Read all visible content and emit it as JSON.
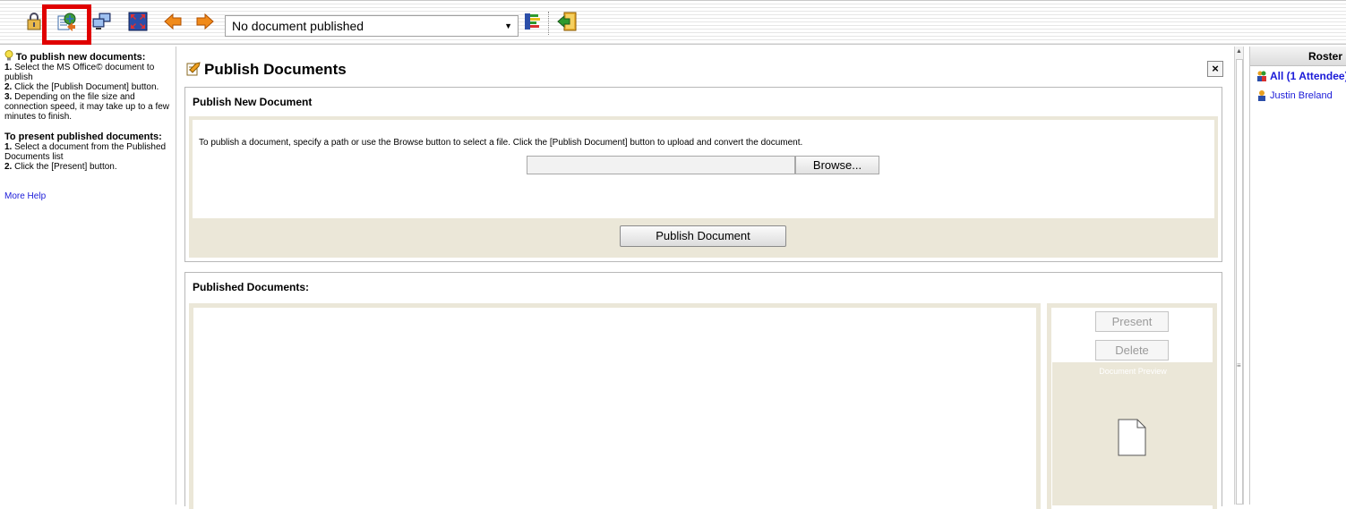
{
  "toolbar": {
    "document_select": {
      "value": "No document published"
    },
    "buttons": [
      "lock-icon",
      "publish-documents-icon",
      "share-desktop-icon",
      "fullscreen-icon",
      "previous-arrow-icon",
      "next-arrow-icon",
      "status-bars-icon",
      "exit-icon"
    ]
  },
  "help": {
    "publish_heading": "To publish new documents:",
    "publish_steps": [
      {
        "num": "1.",
        "text": " Select the MS Office© document to publish"
      },
      {
        "num": "2.",
        "text": " Click the [Publish Document] button."
      },
      {
        "num": "3.",
        "text": " Depending on the file size and connection speed, it may take up to a few minutes to finish."
      }
    ],
    "present_heading": "To present published documents:",
    "present_steps": [
      {
        "num": "1.",
        "text": " Select a document from the Published Documents list"
      },
      {
        "num": "2.",
        "text": " Click the [Present] button."
      }
    ],
    "more_help": "More Help"
  },
  "main": {
    "title": "Publish Documents",
    "close_label": "×",
    "publish_panel": {
      "title": "Publish New Document",
      "description": "To publish a document, specify a path or use the Browse button to select a file. Click the [Publish Document] button to upload and convert the document.",
      "file_value": "",
      "browse_label": "Browse...",
      "publish_label": "Publish Document"
    },
    "published_panel": {
      "title": "Published Documents:",
      "present_label": "Present",
      "delete_label": "Delete",
      "preview_label": "Document Preview"
    }
  },
  "roster": {
    "title": "Roster",
    "all_label": "All (1  Attendee)",
    "attendees": [
      "Justin Breland"
    ]
  },
  "colors": {
    "highlight": "#e00000",
    "panel_beige": "#ebe7d8",
    "link_blue": "#1a1ad8"
  }
}
